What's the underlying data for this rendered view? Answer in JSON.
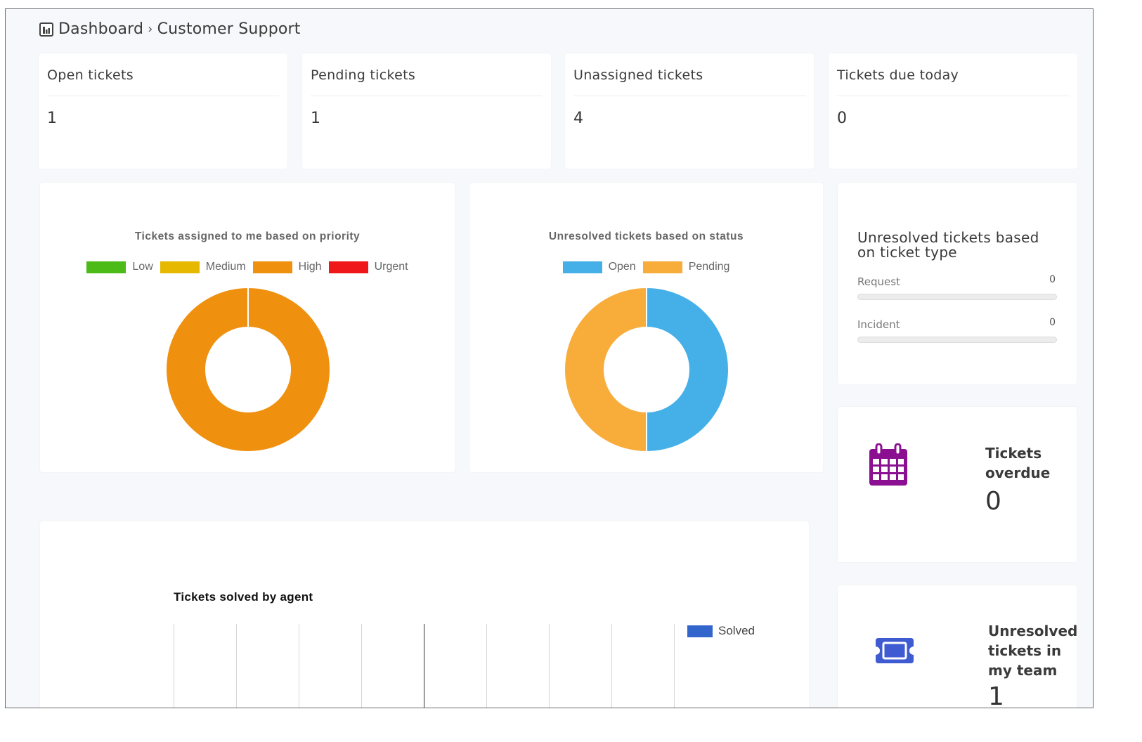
{
  "breadcrumb": {
    "icon": "bar-chart-icon",
    "root": "Dashboard",
    "separator": "›",
    "current": "Customer Support"
  },
  "stats": [
    {
      "title": "Open tickets",
      "value": "1"
    },
    {
      "title": "Pending tickets",
      "value": "1"
    },
    {
      "title": "Unassigned tickets",
      "value": "4"
    },
    {
      "title": "Tickets due today",
      "value": "0"
    }
  ],
  "priority_chart": {
    "title": "Tickets assigned to me based on priority",
    "legend": [
      {
        "label": "Low",
        "color": "#4cbb17"
      },
      {
        "label": "Medium",
        "color": "#e6b800"
      },
      {
        "label": "High",
        "color": "#f0900f"
      },
      {
        "label": "Urgent",
        "color": "#f0171a"
      }
    ]
  },
  "status_chart": {
    "title": "Unresolved tickets based on status",
    "legend": [
      {
        "label": "Open",
        "color": "#45b0e8"
      },
      {
        "label": "Pending",
        "color": "#f8ac3a"
      }
    ]
  },
  "ticket_type": {
    "title": "Unresolved tickets based on ticket type",
    "rows": [
      {
        "label": "Request",
        "value": "0",
        "fraction": 0
      },
      {
        "label": "Incident",
        "value": "0",
        "fraction": 0
      }
    ]
  },
  "overdue": {
    "icon": "calendar-icon",
    "icon_color": "#8b0f91",
    "title": "Tickets overdue",
    "value": "0"
  },
  "team": {
    "icon": "ticket-icon",
    "icon_color": "#3f5bd1",
    "title": "Unresolved tickets in my team",
    "value": "1"
  },
  "chart_data": [
    {
      "type": "pie",
      "title": "Tickets assigned to me based on priority",
      "categories": [
        "Low",
        "Medium",
        "High",
        "Urgent"
      ],
      "values": [
        0,
        0,
        1,
        0
      ],
      "colors": [
        "#4cbb17",
        "#e6b800",
        "#f0900f",
        "#f0171a"
      ],
      "legend": "top"
    },
    {
      "type": "pie",
      "title": "Unresolved tickets based on status",
      "categories": [
        "Open",
        "Pending"
      ],
      "values": [
        1,
        1
      ],
      "colors": [
        "#45b0e8",
        "#f8ac3a"
      ],
      "legend": "top"
    },
    {
      "type": "bar",
      "title": "Tickets solved by agent",
      "series": [
        {
          "name": "Solved",
          "values": [],
          "color": "#3366cc"
        }
      ],
      "categories": [],
      "gridlines": 9,
      "legend": "right"
    }
  ]
}
